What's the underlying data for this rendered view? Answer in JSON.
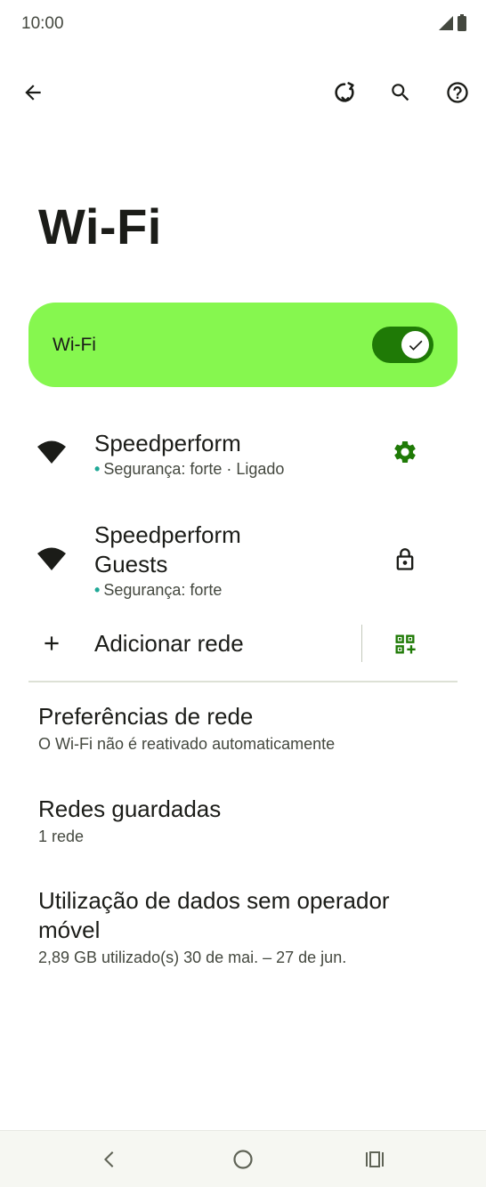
{
  "status_bar": {
    "time": "10:00"
  },
  "page": {
    "title": "Wi-Fi"
  },
  "master_switch": {
    "label": "Wi-Fi",
    "checked": true
  },
  "networks": [
    {
      "name": "Speedperform",
      "summary": "Segurança: forte · Ligado",
      "action_icon": "gear-icon"
    },
    {
      "name": "Speedperform Guests",
      "summary": "Segurança: forte",
      "action_icon": "lock-icon"
    }
  ],
  "add_network": {
    "label": "Adicionar rede"
  },
  "preferences": [
    {
      "title": "Preferências de rede",
      "summary": "O Wi-Fi não é reativado automaticamente"
    },
    {
      "title": "Redes guardadas",
      "summary": "1 rede"
    },
    {
      "title": "Utilização de dados sem operador móvel",
      "summary": "2,89 GB utilizado(s) 30 de mai. – 27 de jun."
    }
  ],
  "colors": {
    "accent": "#1f7a06",
    "switch_bar": "#86f74f",
    "dot": "#1ea896"
  }
}
